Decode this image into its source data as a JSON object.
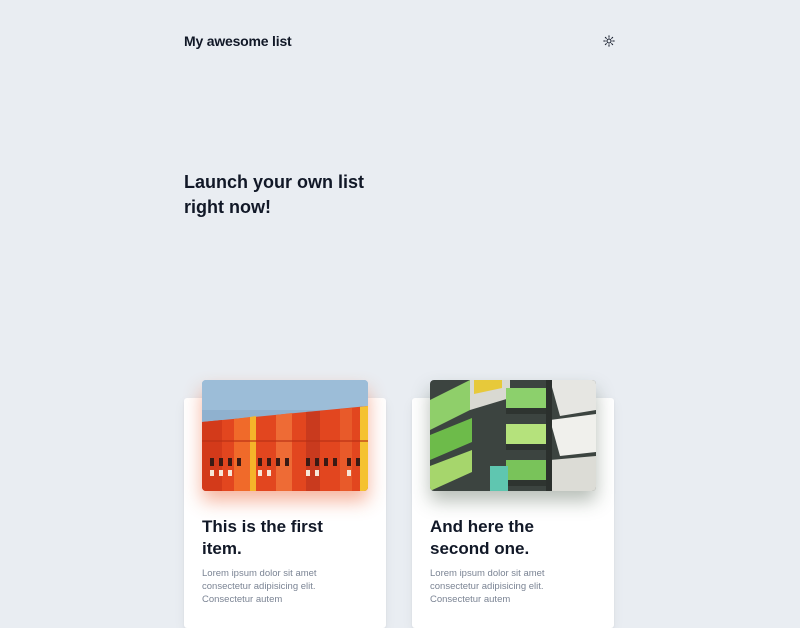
{
  "header": {
    "brand": "My awesome list",
    "theme_toggle_icon": "sun-icon"
  },
  "hero": {
    "lines": [
      "Launch your own list",
      "right now!"
    ]
  },
  "cards": [
    {
      "image": "orange-building-photo",
      "title_lines": [
        "This is the first",
        "item."
      ],
      "text_lines": [
        "Lorem ipsum dolor sit amet",
        "consectetur adipisicing elit.",
        "Consectetur autem"
      ]
    },
    {
      "image": "green-balconies-photo",
      "title_lines": [
        "And here the",
        "second one."
      ],
      "text_lines": [
        "Lorem ipsum dolor sit amet",
        "consectetur adipisicing elit.",
        "Consectetur autem"
      ]
    }
  ],
  "colors": {
    "background": "#e9edf2",
    "text": "#111827",
    "muted_text": "#7b8494"
  }
}
